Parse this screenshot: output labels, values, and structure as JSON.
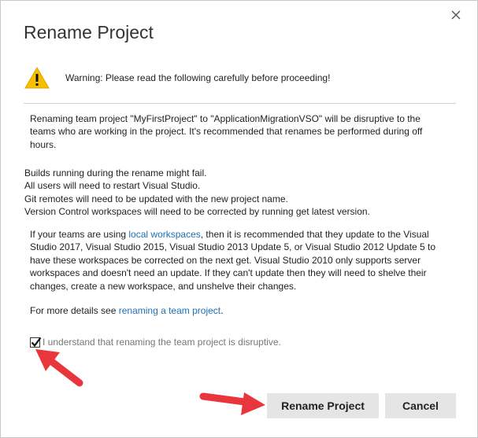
{
  "dialog": {
    "title": "Rename Project",
    "close_icon": "close-icon",
    "warning": {
      "icon": "warning-triangle-icon",
      "text": "Warning: Please read the following carefully before proceeding!"
    },
    "paragraph1": "Renaming team project \"MyFirstProject\" to \"ApplicationMigrationVSO\" will be disruptive to the teams who are working in the project. It's recommended that renames be performed during off hours.",
    "consequences": [
      "Builds running during the rename might fail.",
      "All users will need to restart Visual Studio.",
      "Git remotes will need to be updated with the new project name.",
      "Version Control workspaces will need to be corrected by running get latest version."
    ],
    "paragraph2": {
      "before_link": "If your teams are using ",
      "link_text": "local workspaces",
      "after_link": ", then it is recommended that they update to the Visual Studio 2017, Visual Studio 2015, Visual Studio 2013 Update 5, or Visual Studio 2012 Update 5 to have these workspaces be corrected on the next get. Visual Studio 2010 only supports server workspaces and doesn't need an update. If they can't update then they will need to shelve their changes, create a new workspace, and unshelve their changes."
    },
    "paragraph3": {
      "before_link": "For more details see ",
      "link_text": "renaming a team project",
      "after_link": "."
    },
    "acknowledge": {
      "checked": true,
      "label": "I understand that renaming the team project is disruptive."
    },
    "buttons": {
      "rename": "Rename Project",
      "cancel": "Cancel"
    },
    "colors": {
      "link": "#1e6fb5",
      "button_bg": "#e5e5e5",
      "warning_yellow": "#f6c000",
      "annotation_arrow": "#e8363c"
    }
  }
}
